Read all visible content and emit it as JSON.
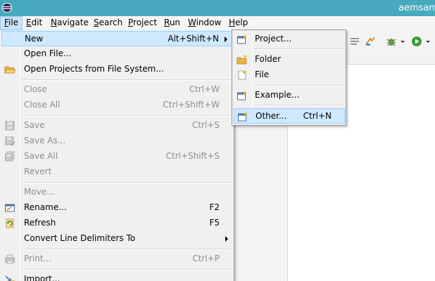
{
  "window": {
    "title": "aemsam"
  },
  "menubar": {
    "items": [
      {
        "mnemonic": "F",
        "rest": "ile"
      },
      {
        "mnemonic": "E",
        "rest": "dit"
      },
      {
        "mnemonic": "N",
        "rest": "avigate"
      },
      {
        "mnemonic": "S",
        "rest": "earch"
      },
      {
        "mnemonic": "P",
        "rest": "roject"
      },
      {
        "mnemonic": "R",
        "rest": "un"
      },
      {
        "mnemonic": "W",
        "rest": "indow"
      },
      {
        "mnemonic": "H",
        "rest": "elp"
      }
    ]
  },
  "file_menu": {
    "items": [
      {
        "label": "New",
        "accel": "Alt+Shift+N",
        "icon": "",
        "submenu": true,
        "enabled": true,
        "active": true
      },
      {
        "label": "Open File...",
        "accel": "",
        "icon": "",
        "enabled": true
      },
      {
        "label": "Open Projects from File System...",
        "accel": "",
        "icon": "open-folder-icon",
        "enabled": true
      },
      {
        "label": "Close",
        "accel": "Ctrl+W",
        "icon": "",
        "enabled": false
      },
      {
        "label": "Close All",
        "accel": "Ctrl+Shift+W",
        "icon": "",
        "enabled": false
      },
      {
        "label": "Save",
        "accel": "Ctrl+S",
        "icon": "save-icon",
        "enabled": false
      },
      {
        "label": "Save As...",
        "accel": "",
        "icon": "save-as-icon",
        "enabled": false
      },
      {
        "label": "Save All",
        "accel": "Ctrl+Shift+S",
        "icon": "save-all-icon",
        "enabled": false
      },
      {
        "label": "Revert",
        "accel": "",
        "icon": "",
        "enabled": false
      },
      {
        "label": "Move...",
        "accel": "",
        "icon": "",
        "enabled": false
      },
      {
        "label": "Rename...",
        "accel": "F2",
        "icon": "rename-icon",
        "enabled": true
      },
      {
        "label": "Refresh",
        "accel": "F5",
        "icon": "refresh-icon",
        "enabled": true
      },
      {
        "label": "Convert Line Delimiters To",
        "accel": "",
        "icon": "",
        "submenu": true,
        "enabled": true
      },
      {
        "label": "Print...",
        "accel": "Ctrl+P",
        "icon": "print-icon",
        "enabled": false
      },
      {
        "label": "Import...",
        "accel": "",
        "icon": "import-icon",
        "enabled": true
      }
    ]
  },
  "new_submenu": {
    "items": [
      {
        "label": "Project...",
        "accel": "",
        "icon": "new-project-icon"
      },
      {
        "label": "Folder",
        "accel": "",
        "icon": "new-folder-icon"
      },
      {
        "label": "File",
        "accel": "",
        "icon": "new-file-icon"
      },
      {
        "label": "Example...",
        "accel": "",
        "icon": "new-example-icon"
      },
      {
        "label": "Other...",
        "accel": "Ctrl+N",
        "icon": "new-wizard-icon",
        "active": true
      }
    ]
  },
  "colors": {
    "titlebar": "#46a9bd",
    "menu_highlight": "#cde8ff",
    "menu_highlight_border": "#99d1ff",
    "disabled_text": "#8d8d8d"
  }
}
